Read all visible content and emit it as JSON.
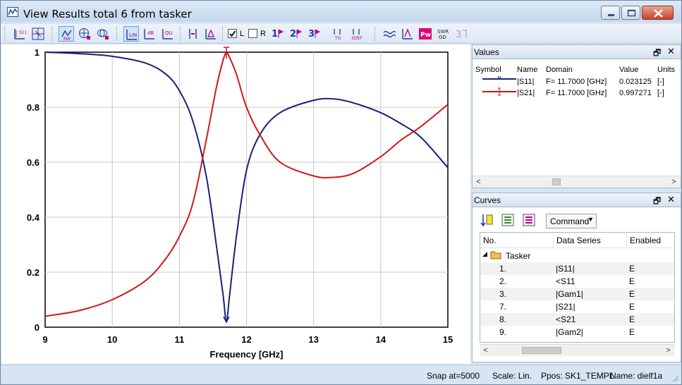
{
  "window": {
    "title": "View Results total 6 from tasker",
    "controls": {
      "minimize": "minimize",
      "maximize": "maximize",
      "close": "close"
    }
  },
  "toolbar": {
    "checkbox_l": {
      "label": "L",
      "checked": true
    },
    "checkbox_r": {
      "label": "R",
      "checked": false
    },
    "icons": [
      "s11-axis-icon",
      "axis-scale-icon",
      "rw-plot-icon",
      "smith-chart-icon",
      "polar-chart-icon",
      "lin-scale-icon",
      "db-scale-icon",
      "qu-scale-icon",
      "marker-icon",
      "marker-delta-icon",
      "marker-1-icon",
      "marker-2-icon",
      "marker-3-icon",
      "marker-to-icon",
      "marker-def-icon",
      "wave-icon",
      "tune-icon",
      "pw-icon",
      "swr-gd-icon",
      "help-icon"
    ],
    "swr_gd_label": "SWR GD"
  },
  "chart_data": {
    "type": "line",
    "xlabel": "Frequency [GHz]",
    "ylabel": "",
    "xlim": [
      9,
      15
    ],
    "ylim": [
      0,
      1
    ],
    "x_ticks": [
      "9",
      "10",
      "11",
      "12",
      "13",
      "14",
      "15"
    ],
    "y_ticks": [
      "0",
      "0.2",
      "0.4",
      "0.6",
      "0.8",
      "1"
    ],
    "grid": true,
    "marker_x": 11.7,
    "series": [
      {
        "name": "|S11|",
        "color": "#1a1f7a",
        "x": [
          9,
          9.5,
          10,
          10.5,
          10.8,
          11.0,
          11.2,
          11.4,
          11.55,
          11.65,
          11.7,
          11.75,
          11.85,
          12.0,
          12.2,
          12.5,
          13.0,
          13.3,
          13.6,
          14.0,
          14.3,
          14.6,
          15.0
        ],
        "values": [
          1.0,
          0.995,
          0.985,
          0.96,
          0.92,
          0.86,
          0.75,
          0.55,
          0.3,
          0.12,
          0.023,
          0.12,
          0.33,
          0.57,
          0.7,
          0.78,
          0.825,
          0.83,
          0.815,
          0.78,
          0.74,
          0.69,
          0.58
        ]
      },
      {
        "name": "|S21|",
        "color": "#d01818",
        "x": [
          9,
          9.5,
          10,
          10.5,
          10.8,
          11.0,
          11.2,
          11.4,
          11.55,
          11.65,
          11.7,
          11.75,
          11.85,
          12.0,
          12.2,
          12.5,
          13.0,
          13.3,
          13.6,
          14.0,
          14.3,
          14.6,
          15.0
        ],
        "values": [
          0.04,
          0.06,
          0.1,
          0.17,
          0.25,
          0.33,
          0.45,
          0.68,
          0.87,
          0.97,
          0.997,
          0.98,
          0.92,
          0.8,
          0.7,
          0.6,
          0.55,
          0.545,
          0.56,
          0.62,
          0.68,
          0.73,
          0.81
        ]
      }
    ]
  },
  "values_panel": {
    "title": "Values",
    "columns": [
      "Symbol",
      "Name",
      "Domain",
      "Value",
      "Units"
    ],
    "rows": [
      {
        "name": "|S11|",
        "domain": "F= 11.7000 [GHz]",
        "value": "0.023125",
        "units": "[-]",
        "color": "#1a1f7a"
      },
      {
        "name": "|S21|",
        "domain": "F= 11.7000 [GHz]",
        "value": "0.997271",
        "units": "[-]",
        "color": "#d01818"
      }
    ]
  },
  "curves_panel": {
    "title": "Curves",
    "command_label": "Command",
    "columns": [
      "No.",
      "Data Series",
      "Enabled"
    ],
    "group": "Tasker",
    "rows": [
      {
        "no": "1.",
        "series": "|S11|",
        "enabled": "E"
      },
      {
        "no": "2.",
        "series": "<S11",
        "enabled": "E"
      },
      {
        "no": "3.",
        "series": "|Gam1|",
        "enabled": "E"
      },
      {
        "no": "7.",
        "series": "|S21|",
        "enabled": "E"
      },
      {
        "no": "8.",
        "series": "<S21",
        "enabled": "E"
      },
      {
        "no": "9.",
        "series": "|Gam2|",
        "enabled": "E"
      }
    ]
  },
  "statusbar": {
    "snap": "Snap at=5000",
    "scale": "Scale: Lin.",
    "ppos": "Ppos: SK1_TEMPL",
    "name": "Name: dielf1a"
  },
  "panel_controls": {
    "restore": "🗗",
    "close": "✕"
  }
}
